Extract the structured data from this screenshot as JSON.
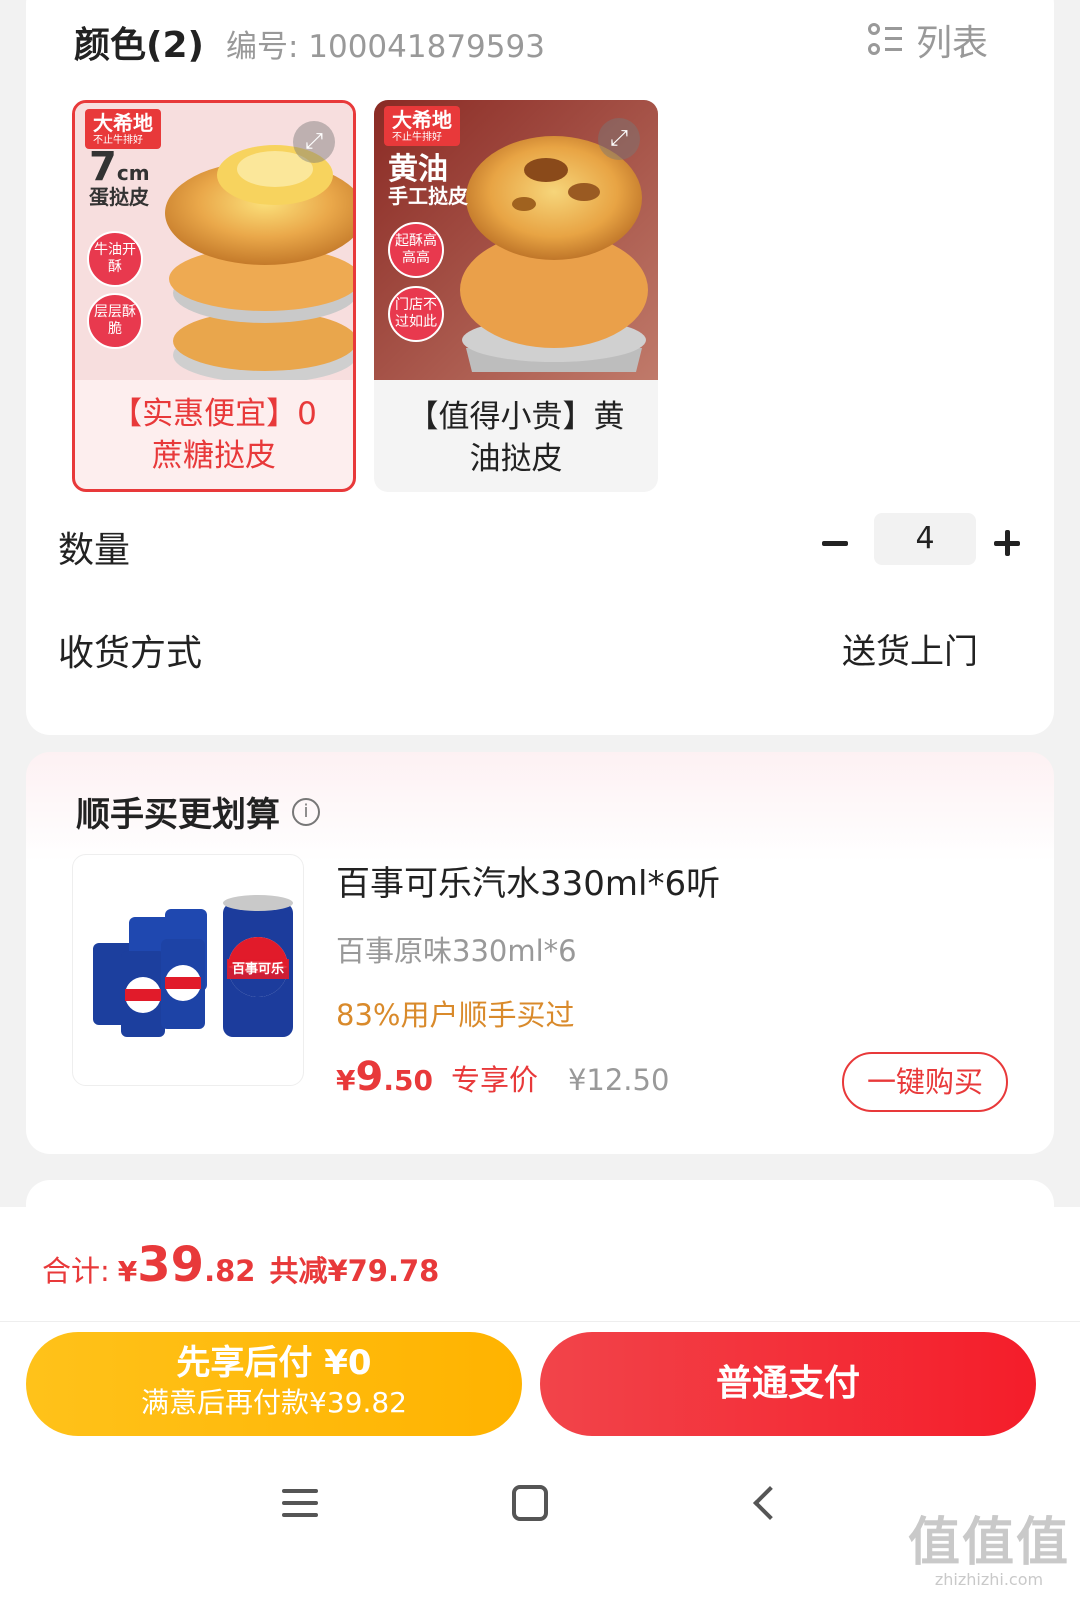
{
  "spec": {
    "color_title": "颜色(2)",
    "sku": "编号: 100041879593",
    "list_toggle": "列表",
    "list_icon": "list-view-icon",
    "variants": [
      {
        "label": "【实惠便宜】0蔗糖挞皮",
        "selected": true,
        "brand": "大希地",
        "brand_sub": "不止牛排好",
        "promo_size": "7",
        "promo_unit": "cm",
        "promo_text": "蛋挞皮",
        "badges": [
          "牛油开酥",
          "层层酥脆"
        ]
      },
      {
        "label": "【值得小贵】黄油挞皮",
        "selected": false,
        "brand": "大希地",
        "brand_sub": "不止牛排好",
        "promo_title": "黄油",
        "promo_text": "手工挞皮",
        "badges": [
          "起酥高高高",
          "门店不过如此"
        ]
      }
    ],
    "quantity_label": "数量",
    "quantity": "4",
    "delivery_label": "收货方式",
    "delivery_value": "送货上门"
  },
  "addon": {
    "title": "顺手买更划算",
    "info_icon": "info-icon",
    "product": {
      "name": "百事可乐汽水330ml*6听",
      "spec": "百事原味330ml*6",
      "tip": "83%用户顺手买过",
      "price_yen": "¥",
      "price_int": "9",
      "price_dec": ".50",
      "price_tag": "专享价",
      "original_price": "¥12.50",
      "can_label": "百事可乐",
      "buy_label": "一键购买"
    }
  },
  "footer": {
    "total_label": "合计:",
    "total_yen": "¥",
    "total_int": "39",
    "total_dec": ".82",
    "discount": "共减¥79.78",
    "pay_later_line1": "先享后付 ¥0",
    "pay_later_line2": "满意后再付款¥39.82",
    "pay_now": "普通支付"
  },
  "watermark": {
    "big": "值值值",
    "small": "zhizhizhi.com"
  },
  "colors": {
    "accent_red": "#e8393a",
    "pay_later_yellow": "#ffbb0f",
    "tip_orange": "#d98a2b"
  }
}
